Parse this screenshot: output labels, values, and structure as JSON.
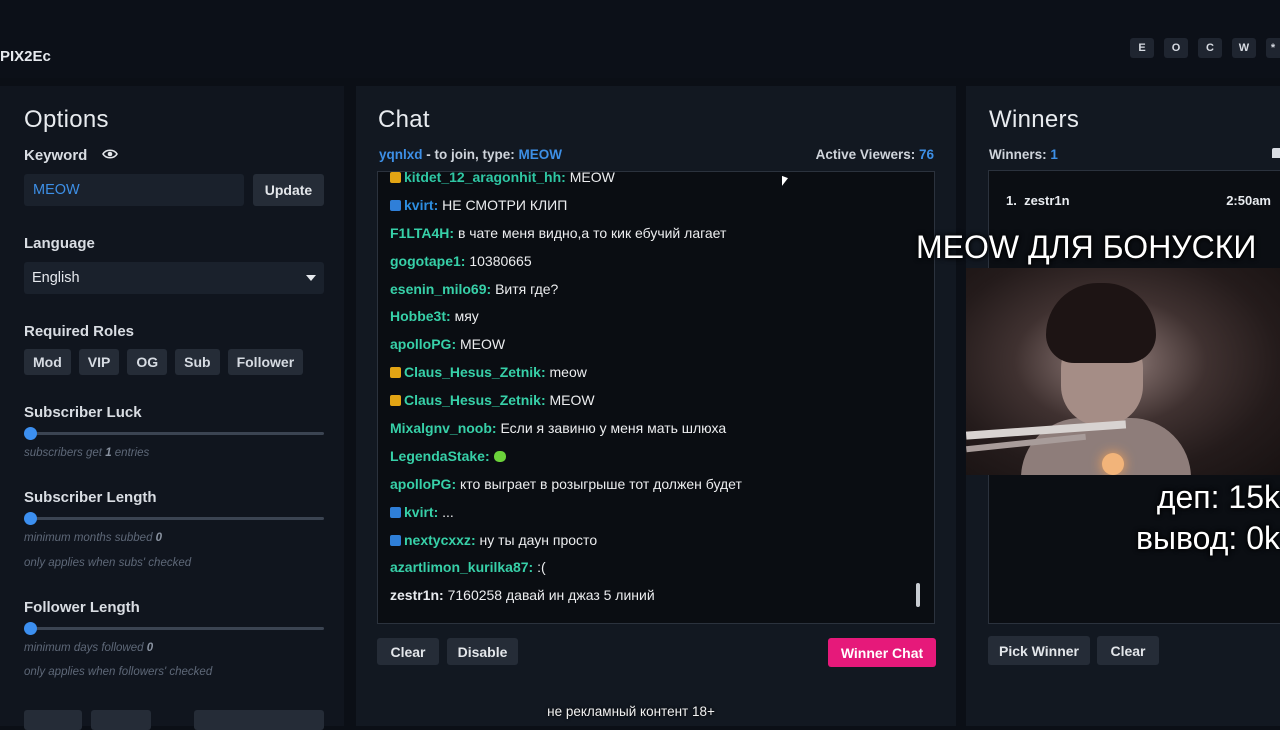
{
  "app": {
    "brand": "PIX2Ec",
    "top_keys": [
      "E",
      "O",
      "C",
      "W",
      "*"
    ]
  },
  "options": {
    "title": "Options",
    "keyword": {
      "label": "Keyword",
      "value": "MEOW",
      "update": "Update"
    },
    "language": {
      "label": "Language",
      "value": "English"
    },
    "required_roles": {
      "label": "Required Roles",
      "roles": [
        "Mod",
        "VIP",
        "OG",
        "Sub",
        "Follower"
      ]
    },
    "subscriber_luck": {
      "label": "Subscriber Luck",
      "hint_pre": "subscribers get ",
      "hint_val": "1",
      "hint_post": " entries",
      "value": 1
    },
    "subscriber_length": {
      "label": "Subscriber Length",
      "hint_pre": "minimum months subbed ",
      "hint_val": "0",
      "note": "only applies when subs' checked",
      "value": 0
    },
    "follower_length": {
      "label": "Follower Length",
      "hint_pre": "minimum days followed ",
      "hint_val": "0",
      "note": "only applies when followers' checked",
      "value": 0
    }
  },
  "chat": {
    "title": "Chat",
    "host": "yqnlxd",
    "join_text": " - to join, type: ",
    "join_keyword": "MEOW",
    "viewers_label": "Active Viewers: ",
    "viewers": "76",
    "messages": [
      {
        "user": "kitdet_12_aragonhit_hh",
        "color": "#2fc7a4",
        "badge": "sub",
        "text": "MEOW"
      },
      {
        "user": "kvirt",
        "color": "#2e8ee0",
        "badge": "prime",
        "text": "НЕ СМОТРИ КЛИП"
      },
      {
        "user": "F1LTA4H",
        "color": "#37d0a8",
        "badge": "",
        "text": "в чате меня видно,а то кик ебучий лагает"
      },
      {
        "user": "gogotape1",
        "color": "#37d0a8",
        "badge": "",
        "text": "10380665"
      },
      {
        "user": "esenin_milo69",
        "color": "#37d0a8",
        "badge": "",
        "text": "Витя где?"
      },
      {
        "user": "Hobbe3t",
        "color": "#37d0a8",
        "badge": "",
        "text": "мяу"
      },
      {
        "user": "apolloPG",
        "color": "#37d0a8",
        "badge": "",
        "text": "MEOW"
      },
      {
        "user": "Claus_Hesus_Zetnik",
        "color": "#37d0a8",
        "badge": "sub",
        "text": "meow"
      },
      {
        "user": "Claus_Hesus_Zetnik",
        "color": "#37d0a8",
        "badge": "sub",
        "text": "MEOW"
      },
      {
        "user": "Mixalgnv_noob",
        "color": "#37d0a8",
        "badge": "",
        "text": "Если я завиню у меня мать шлюха"
      },
      {
        "user": "LegendaStake",
        "color": "#37d0a8",
        "badge": "",
        "text": ""
      },
      {
        "user": "apolloPG",
        "color": "#37d0a8",
        "badge": "",
        "text": "кто выграет в розыгрыше тот должен будет"
      },
      {
        "user": "kvirt",
        "color": "#37d0a8",
        "badge": "prime",
        "text": "..."
      },
      {
        "user": "nextycxxz",
        "color": "#37d0a8",
        "badge": "prime",
        "text": "ну ты даун просто"
      },
      {
        "user": "azartlimon_kurilka87",
        "color": "#37d0a8",
        "badge": "",
        "text": ":("
      },
      {
        "user": "zestr1n",
        "color": "#e8ebef",
        "badge": "",
        "text": "7160258 давай ин джаз 5 линий"
      }
    ],
    "buttons": {
      "clear": "Clear",
      "disable": "Disable",
      "winner_chat": "Winner Chat"
    }
  },
  "winners": {
    "title": "Winners",
    "count_label": "Winners: ",
    "count": "1",
    "list": [
      {
        "rank": "1.",
        "name": "zestr1n",
        "time": "2:50am"
      }
    ],
    "buttons": {
      "pick": "Pick Winner",
      "clear": "Clear"
    }
  },
  "stream_overlay": {
    "headline": "MEOW ДЛЯ БОНУСКИ",
    "dep": "деп: 15k",
    "out": "вывод: 0k",
    "subtitle": "не рекламный контент 18+"
  }
}
